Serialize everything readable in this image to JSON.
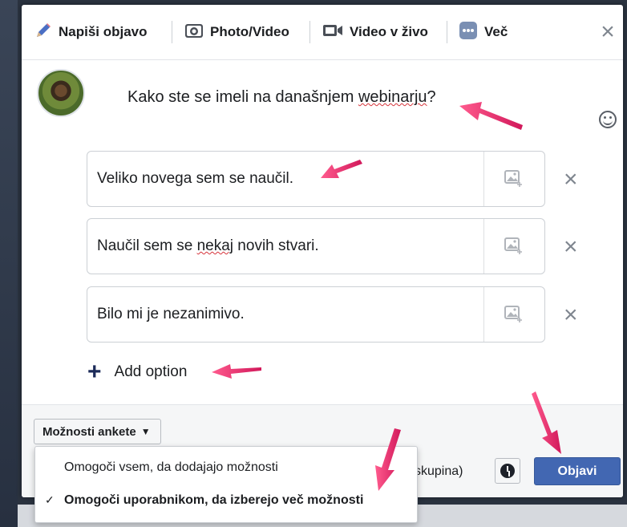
{
  "tabs": [
    {
      "label": "Napiši objavo",
      "icon": "pencil-icon"
    },
    {
      "label": "Photo/Video",
      "icon": "camera-icon"
    },
    {
      "label": "Video v živo",
      "icon": "video-camera-icon"
    },
    {
      "label": "Več",
      "icon": "more-icon"
    }
  ],
  "question": {
    "before": "Kako ste se imeli na današnjem ",
    "misspelled": "webinarju",
    "after": "?"
  },
  "options": [
    {
      "before": "Veliko novega sem se naučil.",
      "misspelled": "",
      "after": ""
    },
    {
      "before": "Naučil sem se ",
      "misspelled": "nekaj",
      "after": " novih stvari."
    },
    {
      "before": "Bilo mi je nezanimivo.",
      "misspelled": "",
      "after": ""
    }
  ],
  "add_option": {
    "label": "Add option"
  },
  "poll_options_button": {
    "label": "Možnosti ankete"
  },
  "menu": {
    "items": [
      {
        "label": "Omogoči vsem, da dodajajo možnosti",
        "checked": false
      },
      {
        "label": "Omogoči uporabnikom, da izberejo več možnosti",
        "checked": true,
        "checkmark": "✓"
      }
    ]
  },
  "footer": {
    "group_text": "skupina)",
    "publish_label": "Objavi"
  },
  "colors": {
    "accent": "#4267b2",
    "annotation_arrow": "#e8306b"
  }
}
